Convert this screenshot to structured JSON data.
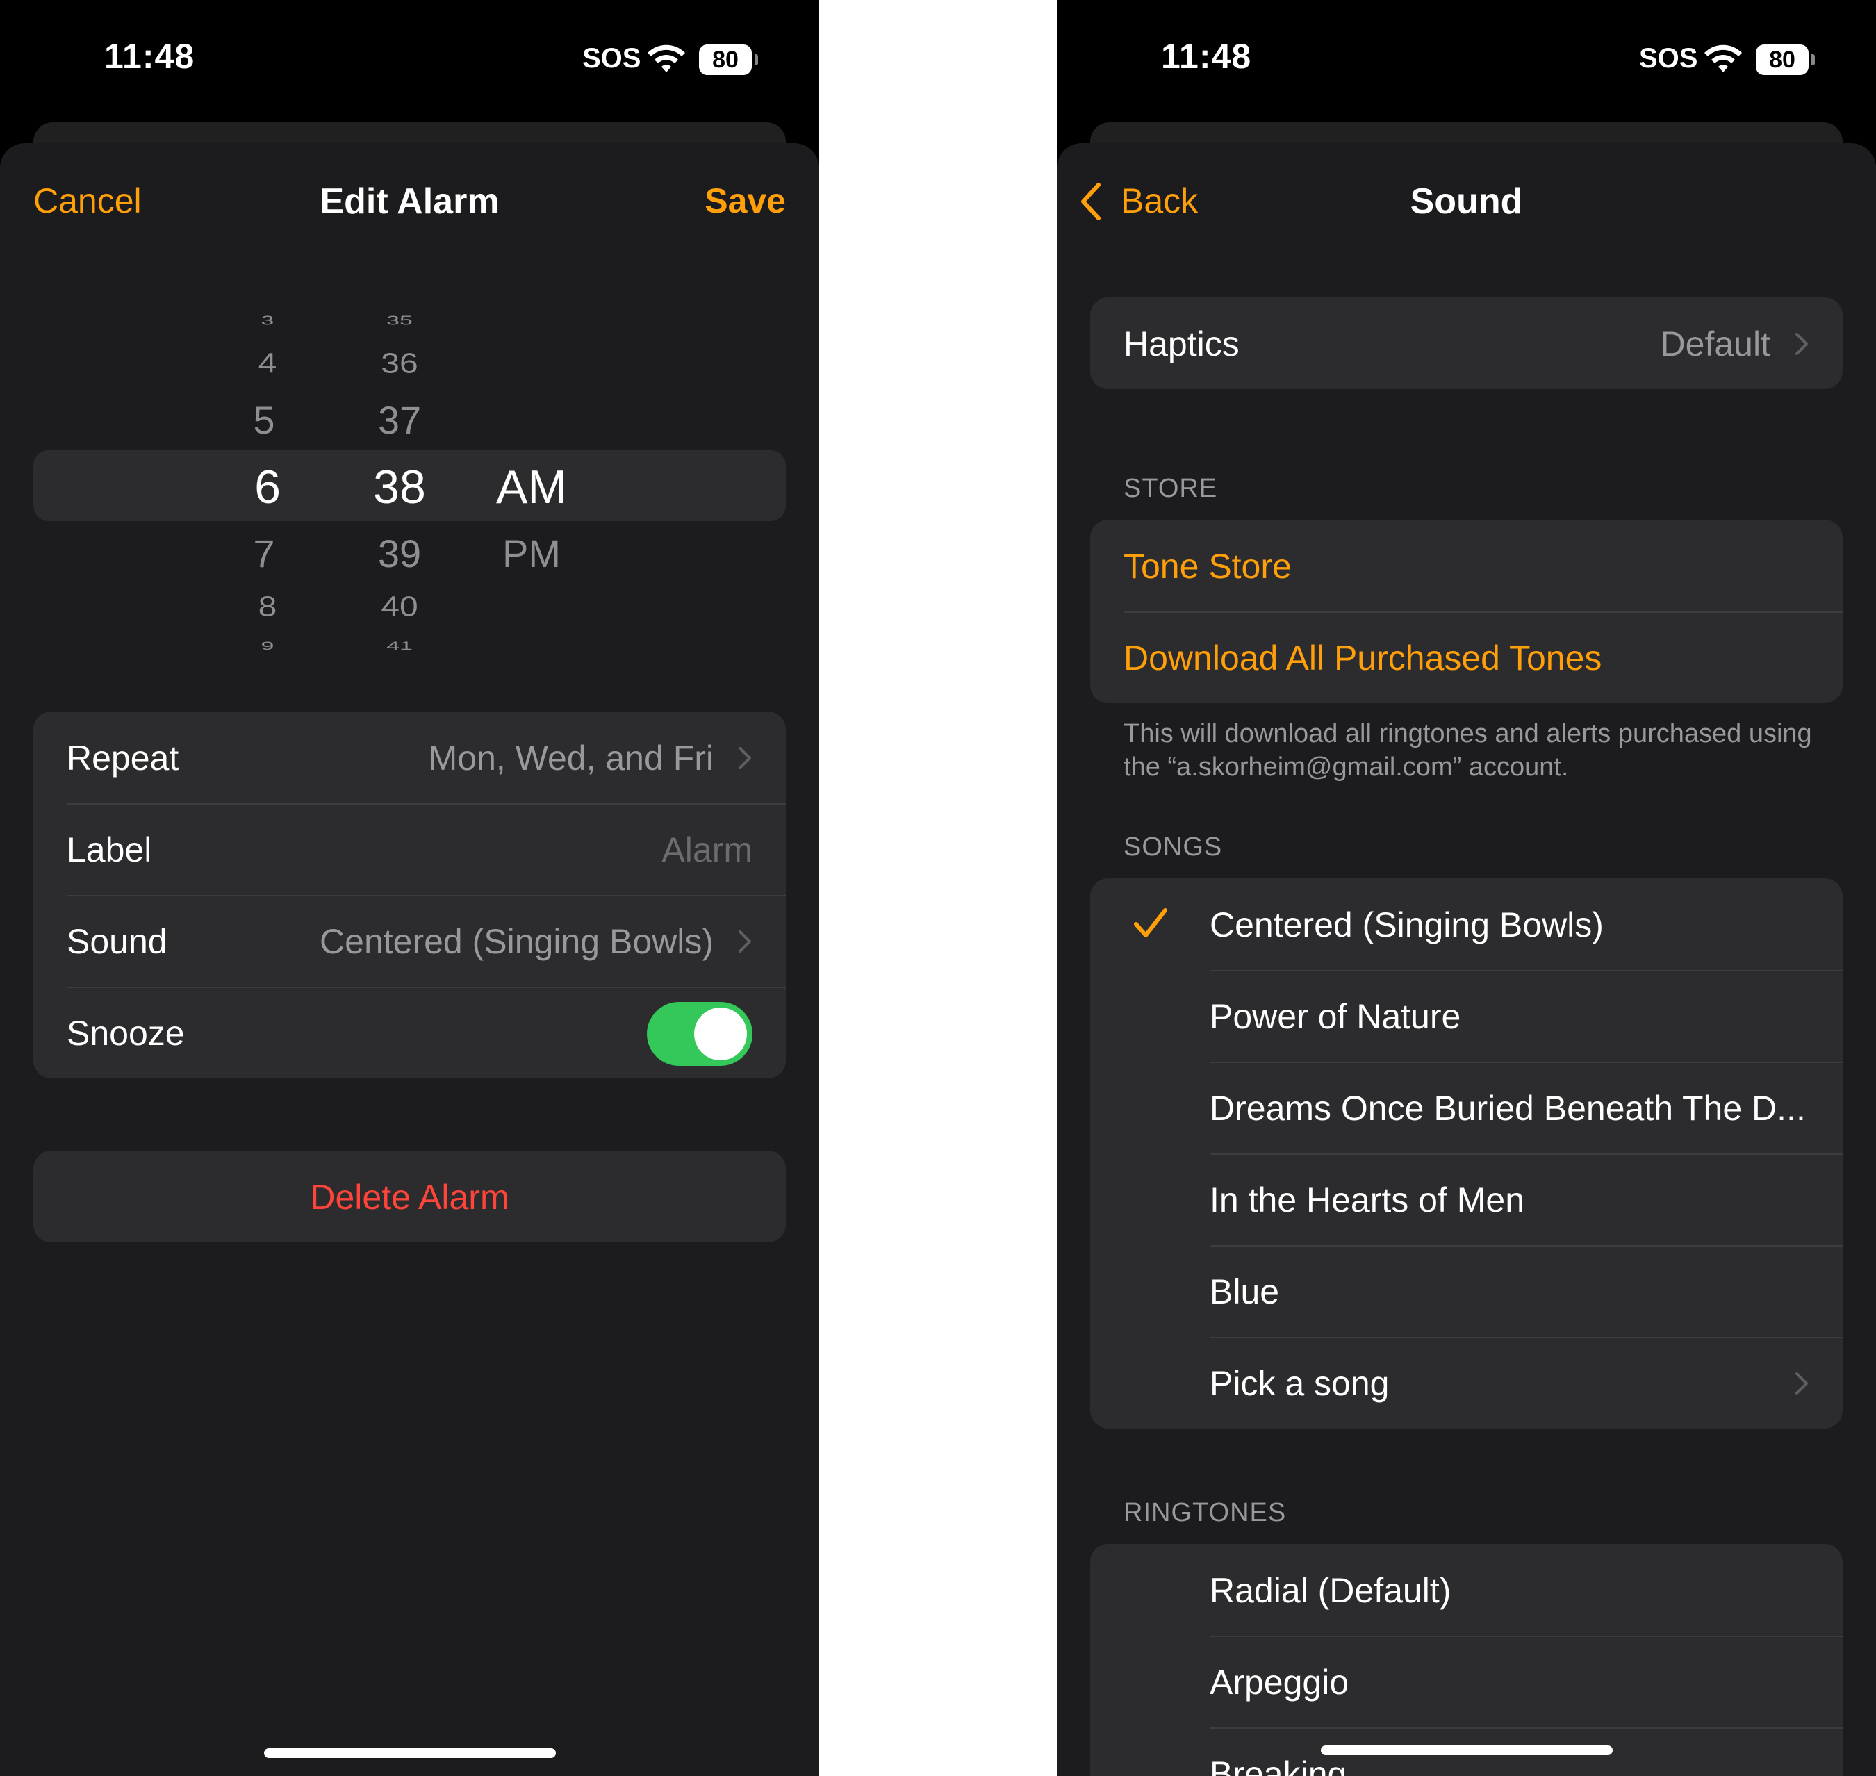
{
  "status": {
    "time": "11:48",
    "carrier": "SOS",
    "battery": "80"
  },
  "edit_alarm": {
    "cancel": "Cancel",
    "title": "Edit Alarm",
    "save": "Save",
    "picker": {
      "hours": [
        "3",
        "4",
        "5",
        "6",
        "7",
        "8",
        "9"
      ],
      "minutes": [
        "35",
        "36",
        "37",
        "38",
        "39",
        "40",
        "41"
      ],
      "periods": [
        "AM",
        "PM"
      ],
      "selected": {
        "hour": "6",
        "minute": "38",
        "period": "AM"
      }
    },
    "rows": {
      "repeat": {
        "label": "Repeat",
        "value": "Mon, Wed, and Fri"
      },
      "label": {
        "label": "Label",
        "placeholder": "Alarm"
      },
      "sound": {
        "label": "Sound",
        "value": "Centered (Singing Bowls)"
      },
      "snooze": {
        "label": "Snooze",
        "on": true
      }
    },
    "delete": "Delete Alarm"
  },
  "sound": {
    "back": "Back",
    "title": "Sound",
    "haptics": {
      "label": "Haptics",
      "value": "Default"
    },
    "store_header": "STORE",
    "tone_store": "Tone Store",
    "download_all": "Download All Purchased Tones",
    "store_footer": "This will download all ringtones and alerts purchased using the “a.skorheim@gmail.com” account.",
    "songs_header": "SONGS",
    "songs": [
      "Centered (Singing Bowls)",
      "Power of Nature",
      "Dreams Once Buried Beneath The D...",
      "In the Hearts of Men",
      "Blue",
      "Pick a song"
    ],
    "selected_song": "Centered (Singing Bowls)",
    "ringtones_header": "RINGTONES",
    "ringtones": [
      "Radial (Default)",
      "Arpeggio",
      "Breaking"
    ]
  },
  "colors": {
    "accent": "#ff9f0a",
    "destructive": "#ff453a",
    "toggle_on": "#34c759",
    "background": "#1c1c1e",
    "cell": "#2c2c2e",
    "secondary_text": "#98989d"
  },
  "icons": [
    "wifi-icon",
    "battery-icon",
    "chevron-right-icon",
    "chevron-left-icon",
    "checkmark-icon"
  ]
}
